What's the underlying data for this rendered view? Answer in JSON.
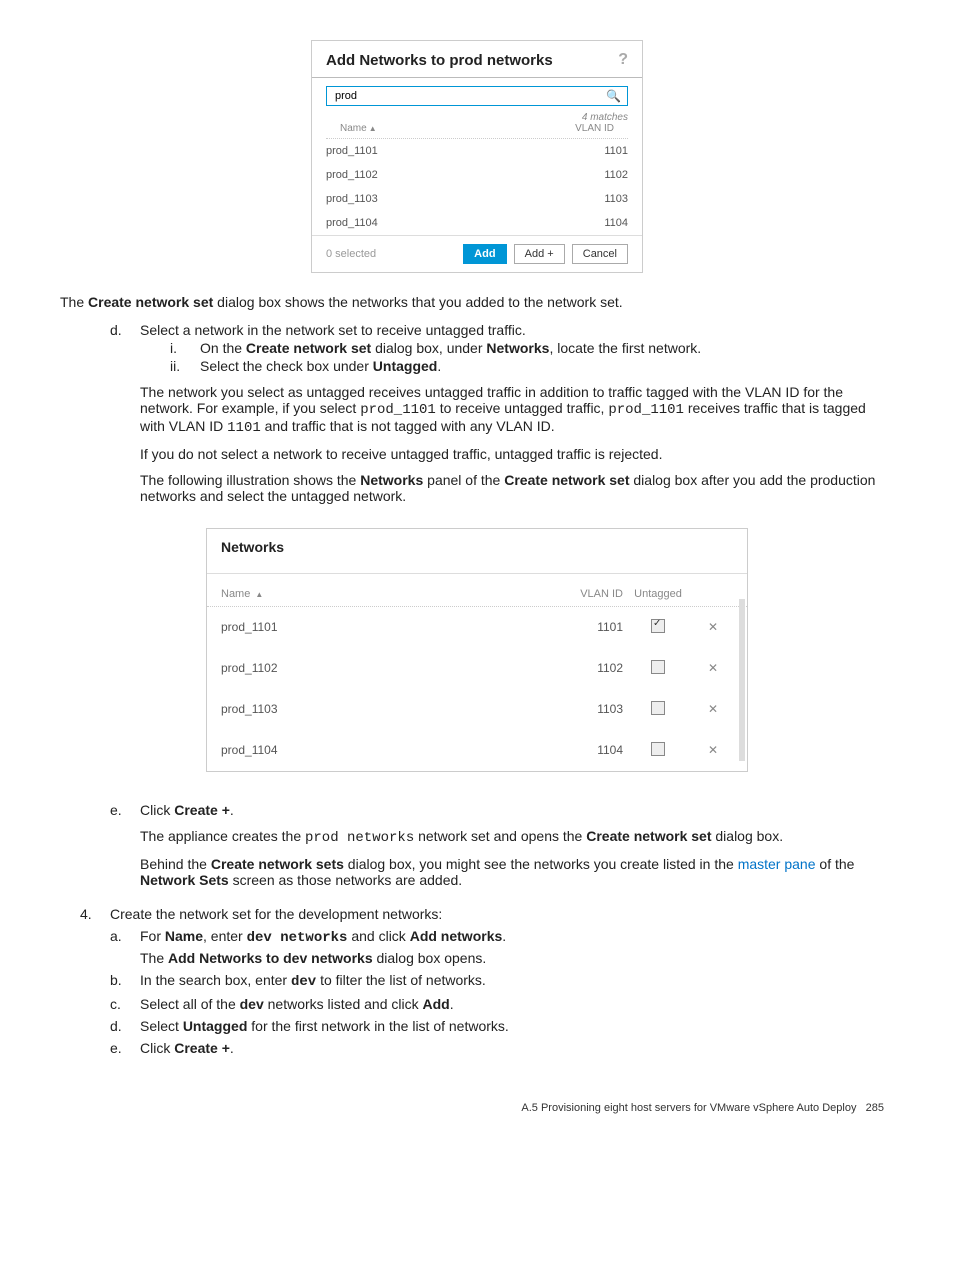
{
  "dialog": {
    "title": "Add Networks to prod networks",
    "help": "?",
    "search_value": "prod",
    "matches_text": "4 matches",
    "col_name": "Name",
    "col_vlan": "VLAN ID",
    "rows": [
      {
        "name": "prod_1101",
        "vlan": "1101"
      },
      {
        "name": "prod_1102",
        "vlan": "1102"
      },
      {
        "name": "prod_1103",
        "vlan": "1103"
      },
      {
        "name": "prod_1104",
        "vlan": "1104"
      }
    ],
    "selected_text": "0 selected",
    "add_label": "Add",
    "add_plus_label": "Add +",
    "cancel_label": "Cancel"
  },
  "texts": {
    "intro": "The ",
    "intro_b": "Create network set",
    "intro_rest": " dialog box shows the networks that you added to the network set.",
    "d_text": "Select a network in the network set to receive untagged traffic.",
    "d_i_pre": "On the ",
    "d_i_b1": "Create network set",
    "d_i_mid": " dialog box, under ",
    "d_i_b2": "Networks",
    "d_i_post": ", locate the first network.",
    "d_ii_pre": "Select the check box under ",
    "d_ii_b": "Untagged",
    "d_ii_post": ".",
    "para_untag1_a": "The network you select as untagged receives untagged traffic in addition to traffic tagged with the VLAN ID for the network. For example, if you select ",
    "para_untag1_code1": "prod_1101",
    "para_untag1_b": " to receive untagged traffic, ",
    "para_untag1_code2": "prod_1101",
    "para_untag1_c": " receives traffic that is tagged with VLAN ID ",
    "para_untag1_code3": "1101",
    "para_untag1_d": " and traffic that is not tagged with any VLAN ID.",
    "para_reject": "If you do not select a network to receive untagged traffic, untagged traffic is rejected.",
    "para_illust_a": "The following illustration shows the ",
    "para_illust_b1": "Networks",
    "para_illust_mid": " panel of the ",
    "para_illust_b2": "Create network set",
    "para_illust_b": " dialog box after you add the production networks and select the untagged network."
  },
  "panel": {
    "title": "Networks",
    "col_name": "Name",
    "col_vlan": "VLAN ID",
    "col_untag": "Untagged",
    "rows": [
      {
        "name": "prod_1101",
        "vlan": "1101",
        "checked": true
      },
      {
        "name": "prod_1102",
        "vlan": "1102",
        "checked": false
      },
      {
        "name": "prod_1103",
        "vlan": "1103",
        "checked": false
      },
      {
        "name": "prod_1104",
        "vlan": "1104",
        "checked": false
      }
    ]
  },
  "step_e": {
    "pre": "Click ",
    "b": "Create +",
    "post": ".",
    "p1_a": "The appliance creates the ",
    "p1_code": "prod networks",
    "p1_b": " network set and opens the ",
    "p1_bold": "Create network set",
    "p1_c": " dialog box.",
    "p2_a": "Behind the ",
    "p2_b1": "Create network sets",
    "p2_mid": " dialog box, you might see the networks you create listed in the ",
    "p2_link": "master pane",
    "p2_mid2": " of the ",
    "p2_b2": "Network Sets",
    "p2_c": " screen as those networks are added."
  },
  "step4": {
    "intro": "Create the network set for the development networks:",
    "a_pre": "For ",
    "a_b1": "Name",
    "a_mid": ", enter ",
    "a_code": "dev networks",
    "a_mid2": " and click ",
    "a_b2": "Add networks",
    "a_post": ".",
    "a_line2_a": "The ",
    "a_line2_b": "Add Networks to dev networks",
    "a_line2_c": " dialog box opens.",
    "b_pre": "In the search box, enter ",
    "b_code": "dev",
    "b_post": " to filter the list of networks.",
    "c_pre": "Select all of the ",
    "c_b": "dev",
    "c_mid": " networks listed and click ",
    "c_b2": "Add",
    "c_post": ".",
    "d_pre": "Select ",
    "d_b": "Untagged",
    "d_post": " for the first network in the list of networks.",
    "e_pre": "Click ",
    "e_b": "Create +",
    "e_post": "."
  },
  "footer": {
    "section": "A.5 Provisioning eight host servers for VMware vSphere Auto Deploy",
    "page": "285"
  },
  "markers": {
    "d": "d.",
    "e": "e.",
    "i": "i.",
    "ii": "ii.",
    "n4": "4.",
    "a": "a.",
    "b": "b.",
    "c": "c."
  }
}
